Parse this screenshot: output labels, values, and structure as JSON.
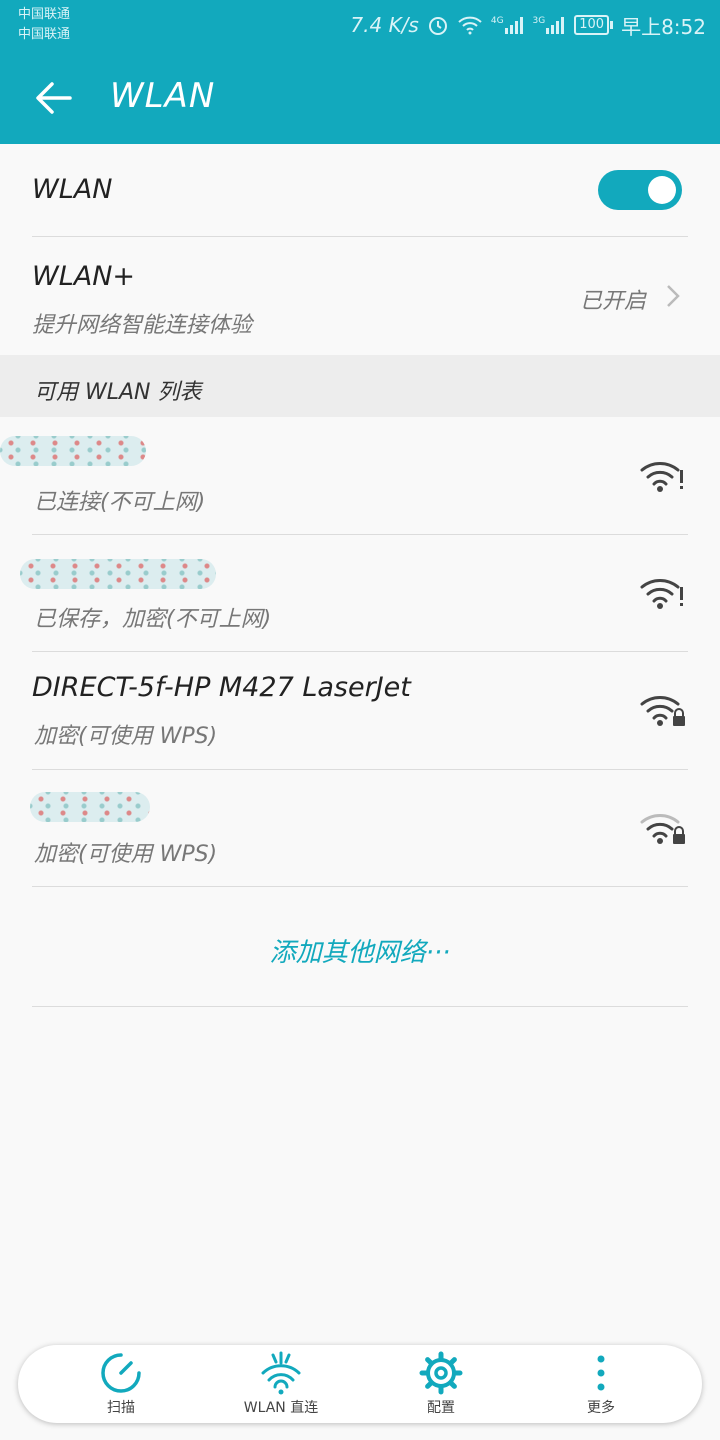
{
  "status": {
    "carrier_1": "中国联通",
    "carrier_2": "中国联通",
    "speed": "7.4 K/s",
    "net_4g": "4G",
    "net_3g": "3G",
    "battery": "100",
    "time": "早上8:52"
  },
  "appbar": {
    "title": "WLAN"
  },
  "wlan_toggle": {
    "label": "WLAN",
    "on": true
  },
  "wlan_plus": {
    "title": "WLAN+",
    "subtitle": "提升网络智能连接体验",
    "value": "已开启"
  },
  "list_header": "可用 WLAN 列表",
  "networks": [
    {
      "ssid": "",
      "state": "已连接(不可上网)",
      "icon": "wifi-warning-icon"
    },
    {
      "ssid": "",
      "state": "已保存，加密(不可上网)",
      "icon": "wifi-warning-icon"
    },
    {
      "ssid": "DIRECT-5f-HP M427 LaserJet",
      "state": "加密(可使用 WPS)",
      "icon": "wifi-lock-icon"
    },
    {
      "ssid": "",
      "state": "加密(可使用 WPS)",
      "icon": "wifi-lock-icon"
    }
  ],
  "add_network": "添加其他网络···",
  "bottom_nav": [
    {
      "label": "扫描",
      "icon": "scan-icon"
    },
    {
      "label": "WLAN 直连",
      "icon": "wifi-direct-icon"
    },
    {
      "label": "配置",
      "icon": "gear-icon"
    },
    {
      "label": "更多",
      "icon": "more-vertical-icon"
    }
  ],
  "colors": {
    "accent": "#12a9bd",
    "background": "#f9f9f9"
  }
}
